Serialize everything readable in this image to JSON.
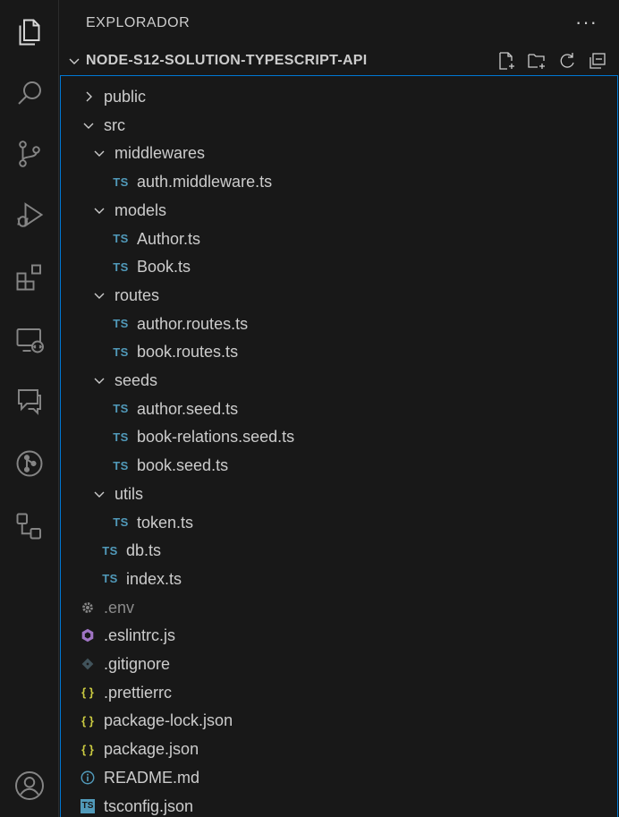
{
  "sidebar": {
    "title": "EXPLORADOR",
    "more_actions": "···"
  },
  "project": {
    "name": "NODE-S12-SOLUTION-TYPESCRIPT-API"
  },
  "tree": [
    {
      "label": "public",
      "kind": "folder",
      "expanded": false,
      "depth": 0
    },
    {
      "label": "src",
      "kind": "folder",
      "expanded": true,
      "depth": 0
    },
    {
      "label": "middlewares",
      "kind": "folder",
      "expanded": true,
      "depth": 1
    },
    {
      "label": "auth.middleware.ts",
      "kind": "ts",
      "depth": 2
    },
    {
      "label": "models",
      "kind": "folder",
      "expanded": true,
      "depth": 1
    },
    {
      "label": "Author.ts",
      "kind": "ts",
      "depth": 2
    },
    {
      "label": "Book.ts",
      "kind": "ts",
      "depth": 2
    },
    {
      "label": "routes",
      "kind": "folder",
      "expanded": true,
      "depth": 1
    },
    {
      "label": "author.routes.ts",
      "kind": "ts",
      "depth": 2
    },
    {
      "label": "book.routes.ts",
      "kind": "ts",
      "depth": 2
    },
    {
      "label": "seeds",
      "kind": "folder",
      "expanded": true,
      "depth": 1
    },
    {
      "label": "author.seed.ts",
      "kind": "ts",
      "depth": 2
    },
    {
      "label": "book-relations.seed.ts",
      "kind": "ts",
      "depth": 2
    },
    {
      "label": "book.seed.ts",
      "kind": "ts",
      "depth": 2
    },
    {
      "label": "utils",
      "kind": "folder",
      "expanded": true,
      "depth": 1
    },
    {
      "label": "token.ts",
      "kind": "ts",
      "depth": 2
    },
    {
      "label": "db.ts",
      "kind": "ts",
      "depth": 1
    },
    {
      "label": "index.ts",
      "kind": "ts",
      "depth": 1
    },
    {
      "label": ".env",
      "kind": "gear",
      "depth": 0,
      "dim": true
    },
    {
      "label": ".eslintrc.js",
      "kind": "eslint",
      "depth": 0
    },
    {
      "label": ".gitignore",
      "kind": "git",
      "depth": 0
    },
    {
      "label": ".prettierrc",
      "kind": "json",
      "depth": 0
    },
    {
      "label": "package-lock.json",
      "kind": "json",
      "depth": 0
    },
    {
      "label": "package.json",
      "kind": "json",
      "depth": 0
    },
    {
      "label": "README.md",
      "kind": "info",
      "depth": 0
    },
    {
      "label": "tsconfig.json",
      "kind": "tsconfig",
      "depth": 0
    }
  ],
  "badges": {
    "ts": "TS",
    "json": "{ }",
    "tsconfig": "TS"
  },
  "colors": {
    "background": "#181818",
    "focus_border": "#0078d4",
    "ts_blue": "#519aba",
    "json_yellow": "#cbcb41",
    "eslint_purple": "#a074c4",
    "icon_gray": "#858585"
  },
  "activity_icons": [
    "explorer-icon",
    "search-icon",
    "source-control-icon",
    "run-debug-icon",
    "extensions-icon",
    "remote-explorer-icon",
    "comments-icon",
    "git-graph-icon",
    "database-icon",
    "account-icon"
  ]
}
